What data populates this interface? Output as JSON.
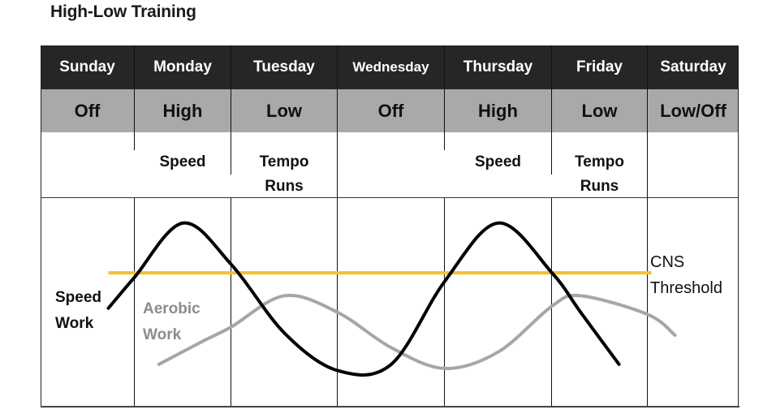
{
  "title": "High-Low Training",
  "days": [
    "Sunday",
    "Monday",
    "Tuesday",
    "Wednesday",
    "Thursday",
    "Friday",
    "Saturday"
  ],
  "intensity": [
    "Off",
    "High",
    "Low",
    "Off",
    "High",
    "Low",
    "Low/Off"
  ],
  "activities": [
    {
      "line1": "",
      "line2": ""
    },
    {
      "line1": "Speed",
      "line2": ""
    },
    {
      "line1": "Tempo",
      "line2": "Runs"
    },
    {
      "line1": "",
      "line2": ""
    },
    {
      "line1": "Speed",
      "line2": ""
    },
    {
      "line1": "Tempo",
      "line2": "Runs"
    },
    {
      "line1": "",
      "line2": ""
    }
  ],
  "labels": {
    "speed_work": {
      "line1": "Speed",
      "line2": "Work"
    },
    "aerobic_work": {
      "line1": "Aerobic",
      "line2": "Work"
    },
    "cns_threshold": {
      "line1": "CNS",
      "line2": "Threshold"
    }
  },
  "colors": {
    "header_bg": "#262626",
    "intensity_bg": "#a9a9a9",
    "speed_curve": "#000000",
    "aerobic_curve": "#a6a6a6",
    "threshold_line": "#f2c12e"
  },
  "curves": {
    "description": "Day-axis from 0 (start of Sunday) to 7 (end of Saturday); level 0 = bottom of chart, 1 = top",
    "speed_work": [
      [
        0.72,
        0.47
      ],
      [
        1.0,
        0.62
      ],
      [
        1.5,
        0.88
      ],
      [
        2.0,
        0.68
      ],
      [
        2.5,
        0.35
      ],
      [
        3.0,
        0.17
      ],
      [
        3.5,
        0.2
      ],
      [
        4.0,
        0.6
      ],
      [
        4.5,
        0.88
      ],
      [
        5.0,
        0.64
      ],
      [
        5.3,
        0.45
      ],
      [
        5.7,
        0.2
      ]
    ],
    "aerobic_work": [
      [
        1.25,
        0.2
      ],
      [
        1.7,
        0.31
      ],
      [
        2.0,
        0.38
      ],
      [
        2.5,
        0.53
      ],
      [
        3.0,
        0.45
      ],
      [
        3.5,
        0.28
      ],
      [
        4.0,
        0.18
      ],
      [
        4.5,
        0.26
      ],
      [
        5.0,
        0.48
      ],
      [
        5.3,
        0.53
      ],
      [
        6.0,
        0.44
      ],
      [
        6.3,
        0.34
      ]
    ],
    "cns_threshold": {
      "level": 0.64,
      "from_day": 0.72,
      "to_day": 6.04
    }
  }
}
